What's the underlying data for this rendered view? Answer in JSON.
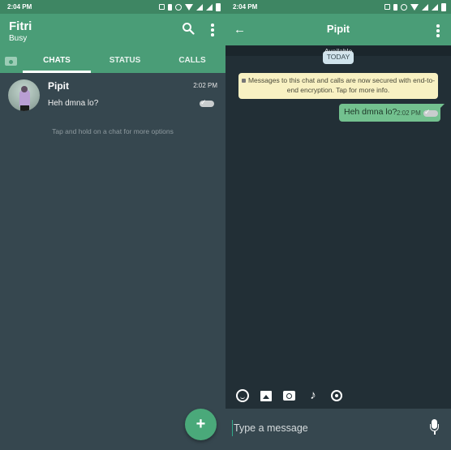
{
  "left": {
    "status_bar": {
      "time": "2:04 PM"
    },
    "header": {
      "title": "Fitri",
      "subtitle": "Busy"
    },
    "icons": {
      "search": "search-icon",
      "more": "more-vert-icon",
      "camera": "camera-icon"
    },
    "tabs": [
      {
        "label": "CHATS",
        "active": true
      },
      {
        "label": "STATUS",
        "active": false
      },
      {
        "label": "CALLS",
        "active": false
      }
    ],
    "chats": [
      {
        "name": "Pipit",
        "time": "2:02 PM",
        "preview": "Heh dmna lo?",
        "status": "read-ticks"
      }
    ],
    "hint": "Tap and hold on a chat for more options",
    "fab": {
      "label": "+",
      "icon": "plus-icon"
    }
  },
  "right": {
    "status_bar": {
      "time": "2:04 PM"
    },
    "header": {
      "title": "Pipit"
    },
    "availability": "Available",
    "date_chip": "TODAY",
    "encryption_notice": "Messages to this chat and calls are now secured with end-to-end encryption. Tap for more info.",
    "messages": [
      {
        "text": "Heh dmna lo?",
        "time": "2:02 PM",
        "outgoing": true,
        "status": "read-ticks"
      }
    ],
    "attachments": [
      "emoji-icon",
      "image-icon",
      "camera-icon",
      "music-icon",
      "location-icon"
    ],
    "input": {
      "placeholder": "Type a message",
      "value": ""
    },
    "colors": {
      "accent": "#4a9d77",
      "bubble": "#73c18f",
      "notice": "#f8f1c2"
    }
  }
}
